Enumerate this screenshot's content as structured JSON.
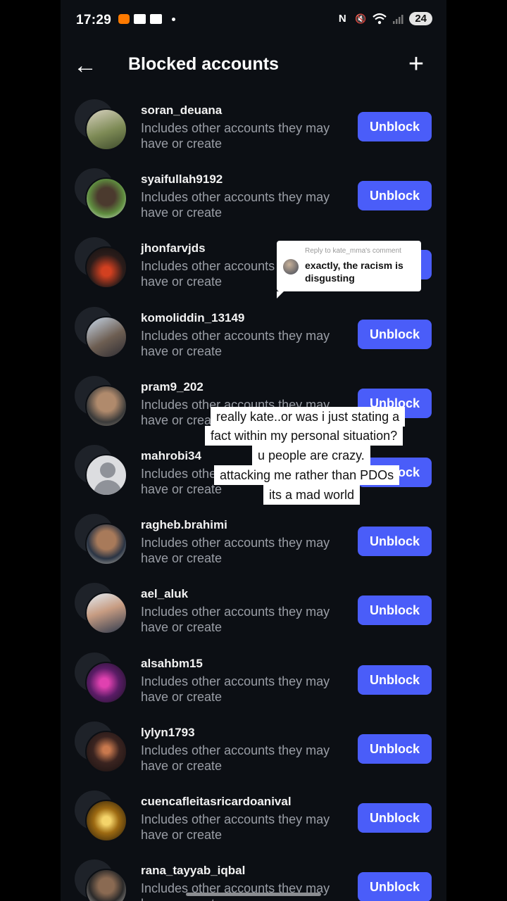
{
  "status_bar": {
    "time": "17:29",
    "battery": "24",
    "nfc_icon": "N",
    "mute_icon": "🔇",
    "wifi_icon": "wifi-icon",
    "signal_icon": "signal-icon"
  },
  "header": {
    "back_icon": "←",
    "title": "Blocked accounts",
    "add_icon": "+"
  },
  "accounts": [
    {
      "username": "soran_deuana",
      "subtext": "Includes other accounts they may have or create",
      "button": "Unblock",
      "avatar": "linear-gradient(160deg,#d8d2c0,#7d8a55 55%,#3e4b2c)"
    },
    {
      "username": "syaifullah9192",
      "subtext": "Includes other accounts they may have or create",
      "button": "Unblock",
      "avatar": "radial-gradient(circle at 50% 45%,#4b3a2e 30%,#5f8d3f 60%,#e8efe6)"
    },
    {
      "username": "jhonfarvjds",
      "subtext": "Includes other accounts they may have or create",
      "button": "Unblock",
      "avatar": "radial-gradient(circle at 50% 60%,#d24020 15%,#2b1c1a 55%,#111)"
    },
    {
      "username": "komoliddin_13149",
      "subtext": "Includes other accounts they may have or create",
      "button": "Unblock",
      "avatar": "linear-gradient(150deg,#c8d8ea,#6d5e52 55%,#2d2c33)"
    },
    {
      "username": "pram9_202",
      "subtext": "Includes other accounts they may have or create",
      "button": "Unblock",
      "avatar": "radial-gradient(circle at 50% 40%,#b08a6c 30%,#3a3a3a 65%,#8e8579)"
    },
    {
      "username": "mahrobi34",
      "subtext": "Includes other accounts they may have or create",
      "button": "Unblock",
      "avatar": "default"
    },
    {
      "username": "ragheb.brahimi",
      "subtext": "Includes other accounts they may have or create",
      "button": "Unblock",
      "avatar": "radial-gradient(circle at 50% 40%,#a87a5a 30%,#2a3444 60%,#cfc8b8)"
    },
    {
      "username": "ael_aluk",
      "subtext": "Includes other accounts they may have or create",
      "button": "Unblock",
      "avatar": "linear-gradient(160deg,#e4eef6,#c79c82 45%,#2f3a4e)"
    },
    {
      "username": "alsahbm15",
      "subtext": "Includes other accounts they may have or create",
      "button": "Unblock",
      "avatar": "radial-gradient(circle at 45% 50%,#e041b0 15%,#5a1c66 50%,#17121f)"
    },
    {
      "username": "lylyn1793",
      "subtext": "Includes other accounts they may have or create",
      "button": "Unblock",
      "avatar": "radial-gradient(circle at 50% 45%,#c9794e 12%,#3b2420 45%,#140f10)"
    },
    {
      "username": "cuencafleitasricardoanival",
      "subtext": "Includes other accounts they may have or create",
      "button": "Unblock",
      "avatar": "radial-gradient(circle at 50% 50%,#f4d46a 15%,#9d6a12 45%,#1b1409)"
    },
    {
      "username": "rana_tayyab_iqbal",
      "subtext": "Includes other accounts they may have or create",
      "button": "Unblock",
      "avatar": "radial-gradient(circle at 50% 40%,#8a6a52 25%,#2b2a2a 55%,#d8d6d2)"
    }
  ],
  "reply_bubble": {
    "meta": "Reply to kate_mma's comment",
    "text": "exactly, the racism is disgusting"
  },
  "captions": [
    "really kate..or was i just stating a",
    "fact within my personal situation?",
    "u people are crazy.",
    "attacking me rather than PDOs",
    "its a mad world"
  ]
}
